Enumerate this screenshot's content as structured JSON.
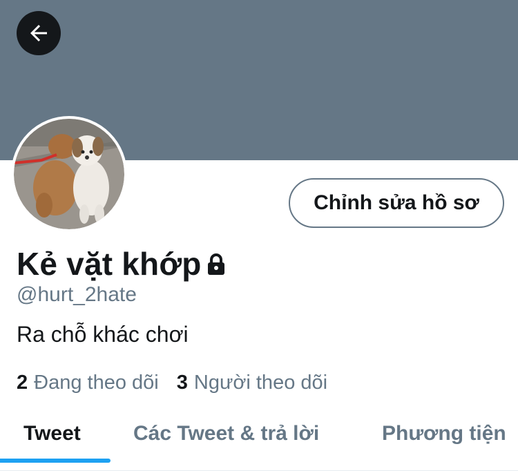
{
  "header": {
    "back_icon": "arrow-left-icon",
    "banner_color": "#657786"
  },
  "profile": {
    "avatar_icon": "dog-photo-avatar",
    "edit_button_label": "Chỉnh sửa hồ sơ",
    "display_name": "Kẻ vặt khớp",
    "protected_icon": "lock-icon",
    "handle": "@hurt_2hate",
    "bio": "Ra chỗ khác chơi",
    "following_count": "2",
    "following_label": "Đang theo dõi",
    "followers_count": "3",
    "followers_label": "Người theo dõi"
  },
  "tabs": [
    {
      "label": "Tweet",
      "active": true
    },
    {
      "label": "Các Tweet & trả lời",
      "active": false
    },
    {
      "label": "Phương tiện",
      "active": false
    }
  ],
  "colors": {
    "accent": "#1da1f2",
    "secondary_text": "#657786",
    "primary_text": "#14171a"
  }
}
